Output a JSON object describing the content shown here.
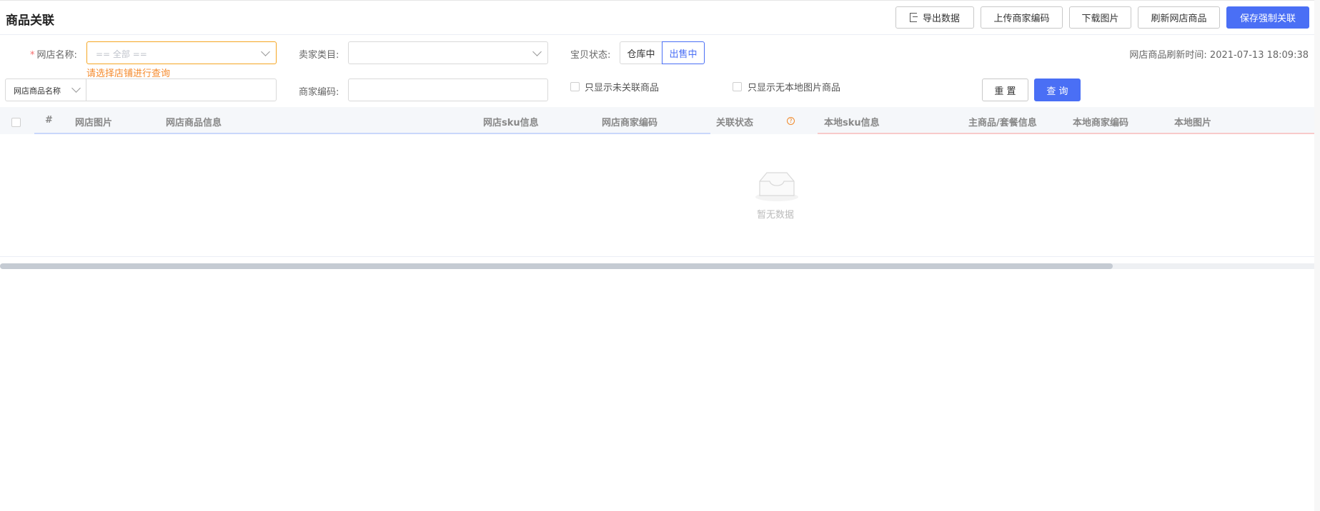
{
  "header": {
    "title": "商品关联",
    "buttons": {
      "export": "导出数据",
      "upload_code": "上传商家编码",
      "download_images": "下载图片",
      "refresh_shop": "刷新网店商品",
      "save_force": "保存强制关联"
    }
  },
  "filters": {
    "shop_name_label": "网店名称:",
    "shop_name_placeholder": "== 全部 ==",
    "shop_name_hint": "请选择店铺进行查询",
    "seller_category_label": "卖家类目:",
    "item_status_label": "宝贝状态:",
    "status_options": [
      "仓库中",
      "出售中"
    ],
    "status_selected": "出售中",
    "refresh_time": "网店商品刷新时间: 2021-07-13 18:09:38",
    "search_type_selected": "网店商品名称",
    "merchant_code_label": "商家编码:",
    "only_unlinked": "只显示未关联商品",
    "only_no_local_image": "只显示无本地图片商品",
    "reset_label": "重 置",
    "query_label": "查 询"
  },
  "table": {
    "columns": [
      "#",
      "网店图片",
      "网店商品信息",
      "网店sku信息",
      "网店商家编码",
      "关联状态",
      "本地sku信息",
      "主商品/套餐信息",
      "本地商家编码",
      "本地图片"
    ],
    "empty_text": "暂无数据"
  },
  "colors": {
    "primary": "#4a6ff5",
    "warning": "#f5a623",
    "hint": "#f58a2c"
  }
}
